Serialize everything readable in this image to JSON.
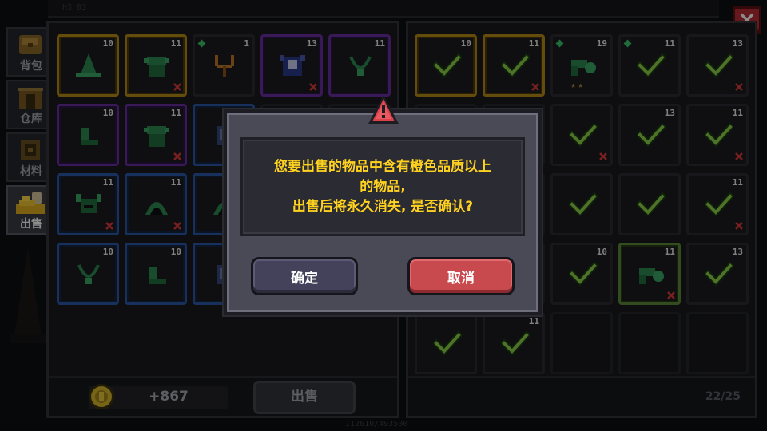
{
  "window": {
    "close_icon": "close-x-icon",
    "top_text": "H3 03",
    "footer_text": "112610/493500"
  },
  "sidebar": {
    "tabs": [
      {
        "label": "背包",
        "icon": "backpack-icon",
        "active": false
      },
      {
        "label": "仓库",
        "icon": "warehouse-icon",
        "active": false
      },
      {
        "label": "材料",
        "icon": "materials-icon",
        "active": false
      },
      {
        "label": "出售",
        "icon": "gold-pile-icon",
        "active": true
      }
    ]
  },
  "inventory": {
    "slots": [
      {
        "level": "10",
        "rarity": "gold",
        "icon": "witch-hat-icon",
        "marked": false,
        "gem": false
      },
      {
        "level": "11",
        "rarity": "gold",
        "icon": "goblin-armor-icon",
        "marked": true,
        "gem": false
      },
      {
        "level": "1",
        "rarity": "none",
        "icon": "slingshot-icon",
        "marked": false,
        "gem": true
      },
      {
        "level": "13",
        "rarity": "purple",
        "icon": "blue-armor-icon",
        "marked": true,
        "gem": false
      },
      {
        "level": "11",
        "rarity": "purple",
        "icon": "necklace-icon",
        "marked": false,
        "gem": false
      },
      {
        "level": "10",
        "rarity": "purple",
        "icon": "boots-icon",
        "marked": false,
        "gem": false
      },
      {
        "level": "11",
        "rarity": "purple",
        "icon": "goblin-armor-icon",
        "marked": true,
        "gem": false
      },
      {
        "level": "",
        "rarity": "blue",
        "icon": "armor-icon",
        "marked": false,
        "gem": false
      },
      {
        "level": "",
        "rarity": "none",
        "icon": "",
        "marked": false,
        "gem": false
      },
      {
        "level": "",
        "rarity": "none",
        "icon": "",
        "marked": false,
        "gem": false
      },
      {
        "level": "11",
        "rarity": "blue",
        "icon": "horned-helmet-icon",
        "marked": true,
        "gem": false
      },
      {
        "level": "11",
        "rarity": "blue",
        "icon": "hood-icon",
        "marked": true,
        "gem": false
      },
      {
        "level": "",
        "rarity": "blue",
        "icon": "hood-icon",
        "marked": false,
        "gem": false
      },
      {
        "level": "",
        "rarity": "none",
        "icon": "",
        "marked": false,
        "gem": false
      },
      {
        "level": "",
        "rarity": "none",
        "icon": "",
        "marked": false,
        "gem": false
      },
      {
        "level": "10",
        "rarity": "blue",
        "icon": "necklace-icon",
        "marked": false,
        "gem": false
      },
      {
        "level": "10",
        "rarity": "blue",
        "icon": "boots-icon",
        "marked": false,
        "gem": false
      },
      {
        "level": "",
        "rarity": "blue",
        "icon": "armor-icon",
        "marked": false,
        "gem": false
      },
      {
        "level": "",
        "rarity": "none",
        "icon": "",
        "marked": false,
        "gem": false
      },
      {
        "level": "",
        "rarity": "none",
        "icon": "",
        "marked": false,
        "gem": false
      }
    ],
    "coins": "+867",
    "sell_label": "出售"
  },
  "sell_list": {
    "slots": [
      {
        "level": "10",
        "rarity": "gold",
        "checked": true,
        "marked": false,
        "gem": false,
        "icon": "check-icon"
      },
      {
        "level": "11",
        "rarity": "gold",
        "checked": true,
        "marked": true,
        "gem": false,
        "icon": "check-icon"
      },
      {
        "level": "19",
        "rarity": "none",
        "checked": false,
        "marked": false,
        "gem": true,
        "icon": "gun-icon",
        "stars": "★★"
      },
      {
        "level": "11",
        "rarity": "none",
        "checked": true,
        "marked": false,
        "gem": true,
        "icon": "check-icon"
      },
      {
        "level": "13",
        "rarity": "none",
        "checked": true,
        "marked": true,
        "gem": false,
        "icon": "check-icon"
      },
      {
        "level": "",
        "rarity": "none",
        "checked": false,
        "marked": false,
        "gem": false,
        "icon": ""
      },
      {
        "level": "",
        "rarity": "none",
        "checked": false,
        "marked": false,
        "gem": false,
        "icon": ""
      },
      {
        "level": "",
        "rarity": "none",
        "checked": true,
        "marked": true,
        "gem": false,
        "icon": "check-icon"
      },
      {
        "level": "13",
        "rarity": "none",
        "checked": true,
        "marked": false,
        "gem": false,
        "icon": "check-icon"
      },
      {
        "level": "11",
        "rarity": "none",
        "checked": true,
        "marked": true,
        "gem": false,
        "icon": "check-icon"
      },
      {
        "level": "",
        "rarity": "none",
        "checked": false,
        "marked": false,
        "gem": false,
        "icon": ""
      },
      {
        "level": "",
        "rarity": "none",
        "checked": false,
        "marked": false,
        "gem": false,
        "icon": ""
      },
      {
        "level": "",
        "rarity": "none",
        "checked": true,
        "marked": false,
        "gem": false,
        "icon": "check-icon"
      },
      {
        "level": "",
        "rarity": "none",
        "checked": true,
        "marked": false,
        "gem": false,
        "icon": "check-icon"
      },
      {
        "level": "11",
        "rarity": "none",
        "checked": true,
        "marked": true,
        "gem": false,
        "icon": "check-icon"
      },
      {
        "level": "",
        "rarity": "none",
        "checked": false,
        "marked": false,
        "gem": false,
        "icon": ""
      },
      {
        "level": "",
        "rarity": "none",
        "checked": false,
        "marked": false,
        "gem": false,
        "icon": ""
      },
      {
        "level": "10",
        "rarity": "none",
        "checked": true,
        "marked": false,
        "gem": false,
        "icon": "check-icon"
      },
      {
        "level": "11",
        "rarity": "green",
        "checked": false,
        "marked": true,
        "gem": false,
        "icon": "gun-icon"
      },
      {
        "level": "13",
        "rarity": "none",
        "checked": true,
        "marked": false,
        "gem": false,
        "icon": "check-icon"
      },
      {
        "level": "",
        "rarity": "none",
        "checked": true,
        "marked": false,
        "gem": false,
        "icon": "check-icon"
      },
      {
        "level": "11",
        "rarity": "none",
        "checked": true,
        "marked": false,
        "gem": false,
        "icon": "check-icon"
      },
      {
        "level": "",
        "rarity": "none",
        "checked": false,
        "marked": false,
        "gem": false,
        "icon": ""
      },
      {
        "level": "",
        "rarity": "none",
        "checked": false,
        "marked": false,
        "gem": false,
        "icon": ""
      },
      {
        "level": "",
        "rarity": "none",
        "checked": false,
        "marked": false,
        "gem": false,
        "icon": ""
      }
    ],
    "capacity": "22/25"
  },
  "dialog": {
    "icon": "warning-triangle-icon",
    "message_line1": "您要出售的物品中含有橙色品质以上",
    "message_line2": "的物品,",
    "message_line3": "出售后将永久消失, 是否确认?",
    "confirm_label": "确定",
    "cancel_label": "取消"
  },
  "colors": {
    "dialog_text": "#ffd21f",
    "cancel_button": "#c84a4f",
    "confirm_button": "#43425a",
    "rarity_gold": "#b48a17",
    "rarity_purple": "#6a2fa0",
    "rarity_blue": "#2d58a8"
  }
}
